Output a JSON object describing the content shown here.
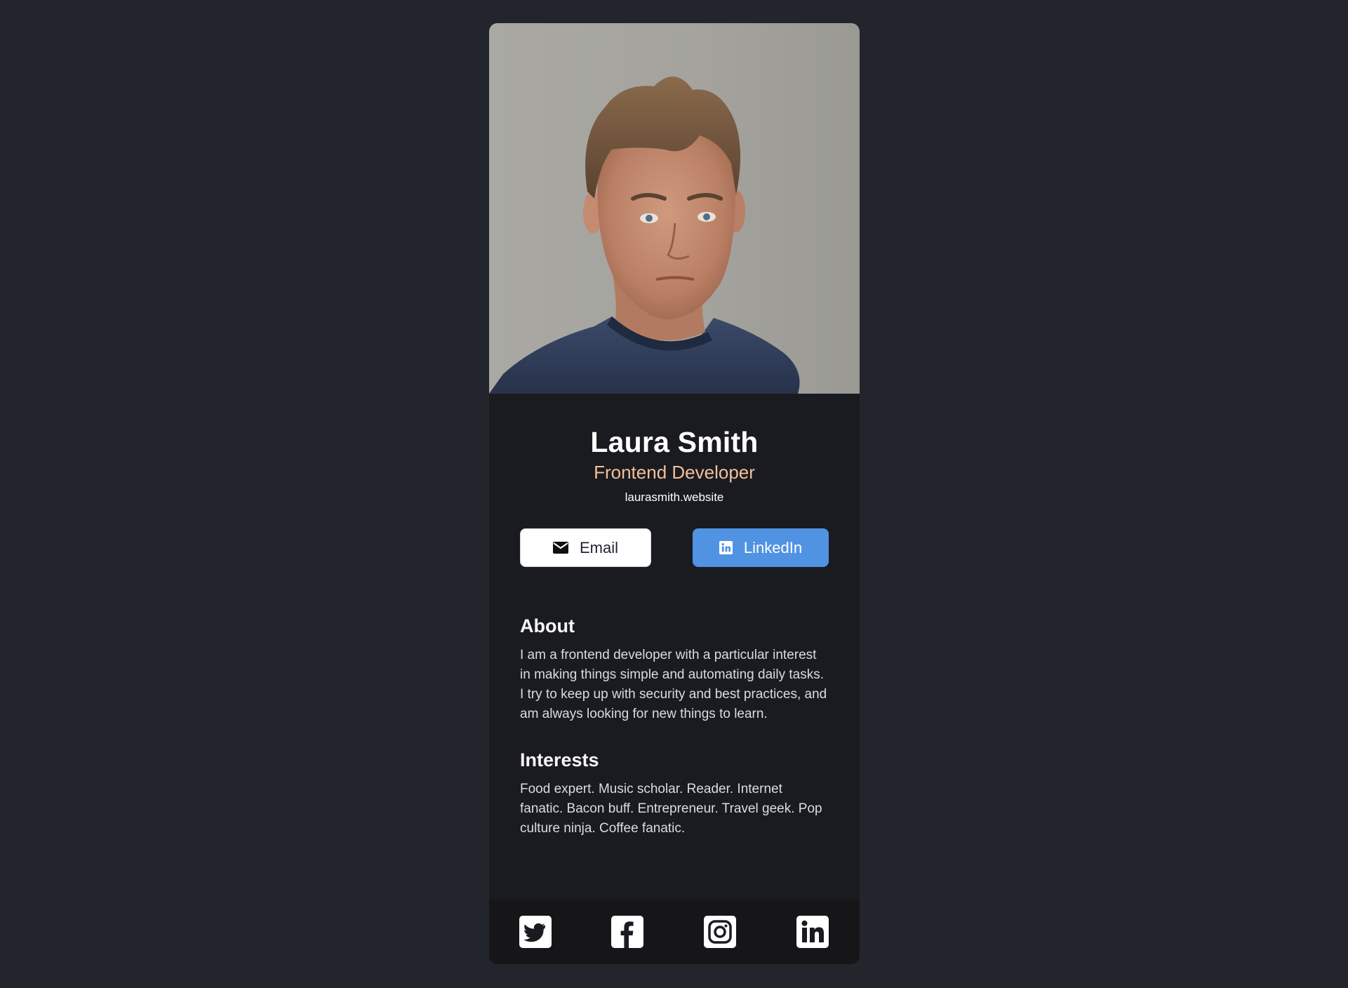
{
  "profile": {
    "photo_alt": "portrait photo",
    "name": "Laura Smith",
    "title": "Frontend Developer",
    "website": "laurasmith.website"
  },
  "buttons": {
    "email_label": "Email",
    "linkedin_label": "LinkedIn"
  },
  "about": {
    "heading": "About",
    "text": "I am a frontend developer with a particular interest in making things simple and automating daily tasks. I try to keep up with security and best practices, and am always looking for new things to learn."
  },
  "interests": {
    "heading": "Interests",
    "text": "Food expert. Music scholar. Reader. Internet fanatic. Bacon buff. Entrepreneur. Travel geek. Pop culture ninja. Coffee fanatic."
  },
  "social_icons": [
    "twitter-icon",
    "facebook-icon",
    "instagram-icon",
    "linkedin-icon"
  ],
  "colors": {
    "page_background": "#23252c",
    "card_background": "#1a1b21",
    "footer_background": "#161619",
    "title_accent": "#f3bf99",
    "linkedin_button": "#5093e2",
    "email_button": "#ffffff"
  }
}
